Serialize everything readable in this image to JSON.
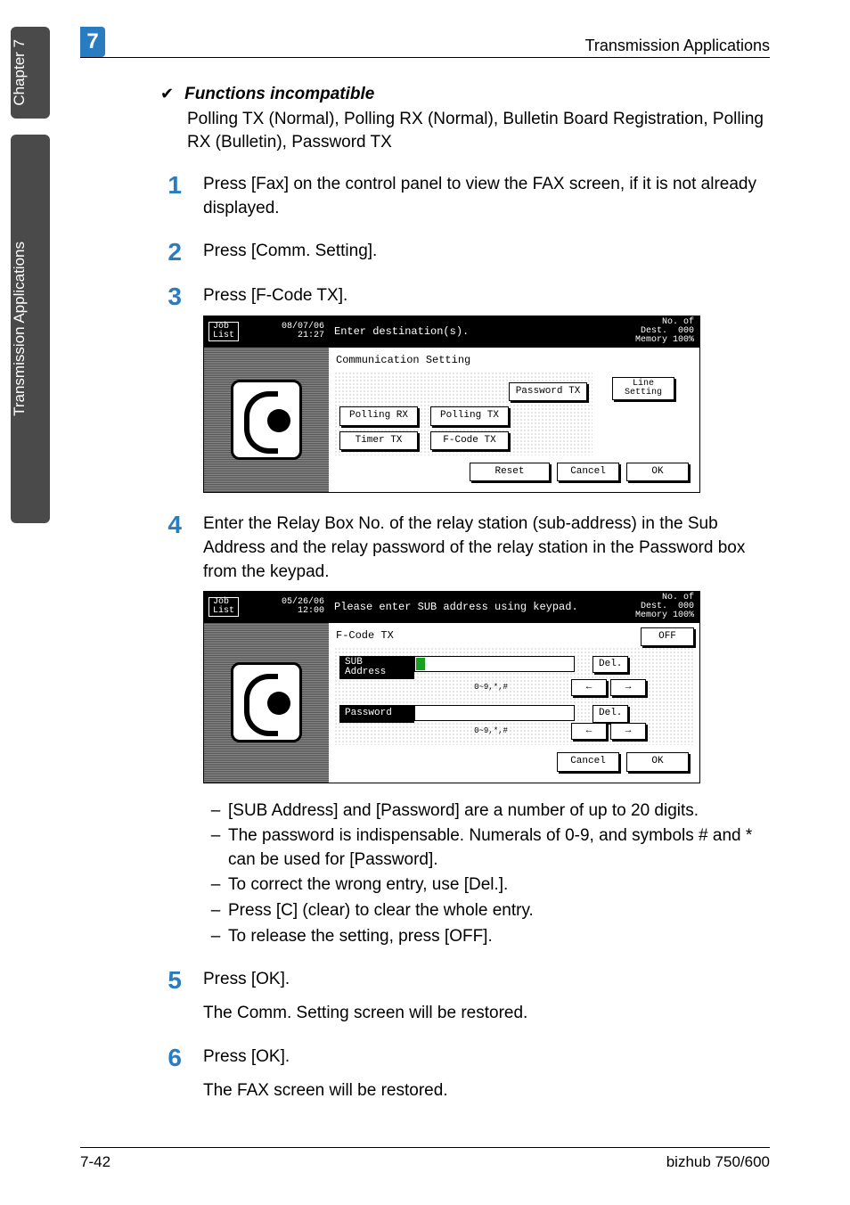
{
  "header": {
    "chapter_number": "7",
    "section_title": "Transmission Applications"
  },
  "side": {
    "tab1": "Chapter 7",
    "tab2": "Transmission Applications"
  },
  "block": {
    "check_title": "Functions incompatible",
    "check_body": "Polling TX (Normal), Polling RX (Normal), Bulletin Board Registration, Polling RX (Bulletin), Password TX"
  },
  "steps": {
    "s1": "Press [Fax] on the control panel to view the FAX screen, if it is not already displayed.",
    "s2": "Press [Comm. Setting].",
    "s3": "Press [F-Code TX].",
    "s4": "Enter the Relay Box No. of the relay station (sub-address) in the Sub Address and the relay password of the relay station in the Password box from the keypad.",
    "s5": "Press [OK].",
    "s5_extra": "The Comm. Setting screen will be restored.",
    "s6": "Press [OK].",
    "s6_extra": "The FAX screen will be restored."
  },
  "screen1": {
    "job_list": "Job\nList",
    "datetime": "08/07/06\n21:27",
    "prompt": "Enter destination(s).",
    "no_of_dest": "No. of\nDest.",
    "count": "000",
    "memory": "Memory 100%",
    "panel_title": "Communication Setting",
    "password_tx": "Password TX",
    "line_setting": "Line\nSetting",
    "polling_rx": "Polling RX",
    "polling_tx": "Polling TX",
    "timer_tx": "Timer TX",
    "fcode_tx": "F-Code TX",
    "reset": "Reset",
    "cancel": "Cancel",
    "ok": "OK"
  },
  "screen2": {
    "job_list": "Job\nList",
    "datetime": "05/26/06\n12:00",
    "prompt": "Please enter SUB address using keypad.",
    "no_of_dest": "No. of\nDest.",
    "count": "000",
    "memory": "Memory 100%",
    "panel_title": "F-Code TX",
    "off": "OFF",
    "sub_address": "SUB\nAddress",
    "password": "Password",
    "hint": "0~9,*,#",
    "left": "←",
    "right": "→",
    "del": "Del.",
    "cancel": "Cancel",
    "ok": "OK"
  },
  "bullets": {
    "b1": "[SUB Address] and [Password] are a number of up to 20 digits.",
    "b2": "The password is indispensable. Numerals of 0-9, and symbols # and * can be used for [Password].",
    "b3": "To correct the wrong entry, use [Del.].",
    "b4": "Press [C] (clear) to clear the whole entry.",
    "b5": "To release the setting, press [OFF]."
  },
  "footer": {
    "left": "7-42",
    "right": "bizhub 750/600"
  }
}
